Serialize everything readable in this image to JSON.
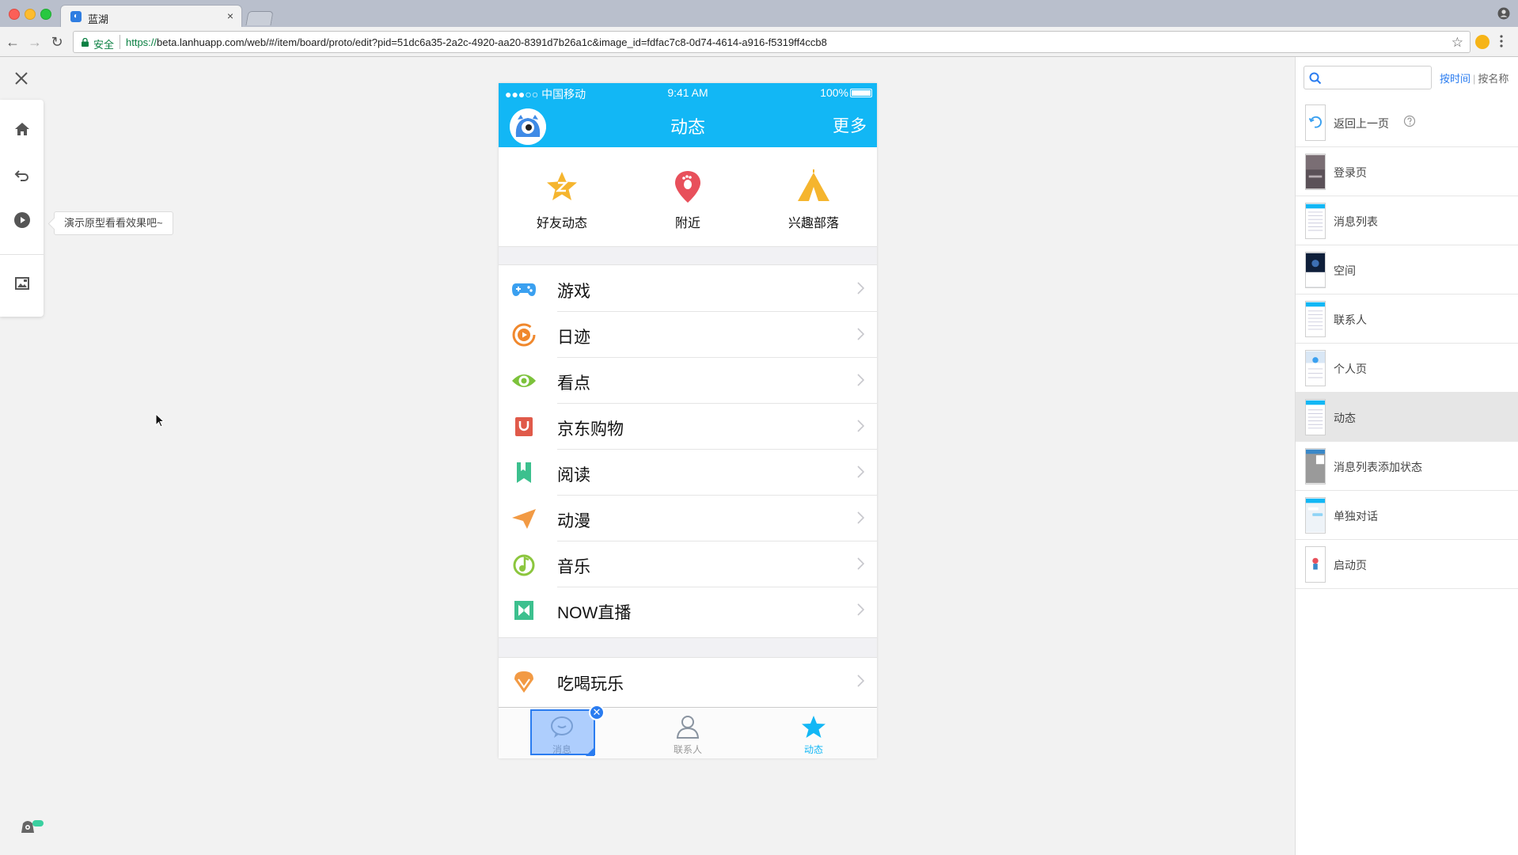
{
  "browser": {
    "tab_title": "蓝湖",
    "tab_close": "×",
    "secure_label": "安全",
    "url_protocol": "https://",
    "url_rest": "beta.lanhuapp.com/web/#/item/board/proto/edit?pid=51dc6a35-2a2c-4920-aa20-8391d7b26a1c&image_id=fdfac7c8-0d74-4614-a916-f5319ff4ccb8",
    "nav_back": "←",
    "nav_forward": "→",
    "nav_reload": "↻",
    "bookmark": "☆"
  },
  "left_tools": {
    "tooltip": "演示原型看看效果吧~",
    "icons": [
      "close-icon",
      "home-icon",
      "undo-icon",
      "play-icon",
      "image-icon"
    ]
  },
  "phone": {
    "status": {
      "carrier": "●●●○○ 中国移动",
      "time": "9:41 AM",
      "battery": "100%"
    },
    "header": {
      "title": "动态",
      "more": "更多"
    },
    "quick": [
      {
        "label": "好友动态",
        "icon": "star-z-icon"
      },
      {
        "label": "附近",
        "icon": "location-pin-icon"
      },
      {
        "label": "兴趣部落",
        "icon": "tent-icon"
      }
    ],
    "menu": [
      {
        "label": "游戏",
        "icon": "gamepad-icon",
        "color": "#3aa0f0"
      },
      {
        "label": "日迹",
        "icon": "video-circle-icon",
        "color": "#f0882d"
      },
      {
        "label": "看点",
        "icon": "eye-icon",
        "color": "#7cc23b"
      },
      {
        "label": "京东购物",
        "icon": "shopping-bag-icon",
        "color": "#e05a4a"
      },
      {
        "label": "阅读",
        "icon": "book-icon",
        "color": "#3cc08e"
      },
      {
        "label": "动漫",
        "icon": "paper-plane-icon",
        "color": "#f29a44"
      },
      {
        "label": "音乐",
        "icon": "music-icon",
        "color": "#8cc63e"
      },
      {
        "label": "NOW直播",
        "icon": "now-live-icon",
        "color": "#3cc08e"
      }
    ],
    "menu2": [
      {
        "label": "吃喝玩乐",
        "icon": "ice-cream-icon",
        "color": "#f29a44"
      }
    ],
    "tabbar": [
      {
        "label": "消息",
        "icon": "chat-icon"
      },
      {
        "label": "联系人",
        "icon": "person-icon"
      },
      {
        "label": "动态",
        "icon": "star-icon"
      }
    ],
    "badge": "✕",
    "accent": "#12b7f5"
  },
  "right_panel": {
    "sort_active": "按时间",
    "sort_sep": "|",
    "sort_other": "按名称",
    "pages": [
      {
        "label": "返回上一页",
        "thumb": "back-page"
      },
      {
        "label": "登录页",
        "thumb": "photo"
      },
      {
        "label": "消息列表",
        "thumb": "list"
      },
      {
        "label": "空间",
        "thumb": "dark"
      },
      {
        "label": "联系人",
        "thumb": "list"
      },
      {
        "label": "个人页",
        "thumb": "profile"
      },
      {
        "label": "动态",
        "thumb": "list",
        "selected": true
      },
      {
        "label": "消息列表添加状态",
        "thumb": "gray"
      },
      {
        "label": "单独对话",
        "thumb": "chat"
      },
      {
        "label": "启动页",
        "thumb": "splash"
      }
    ]
  }
}
